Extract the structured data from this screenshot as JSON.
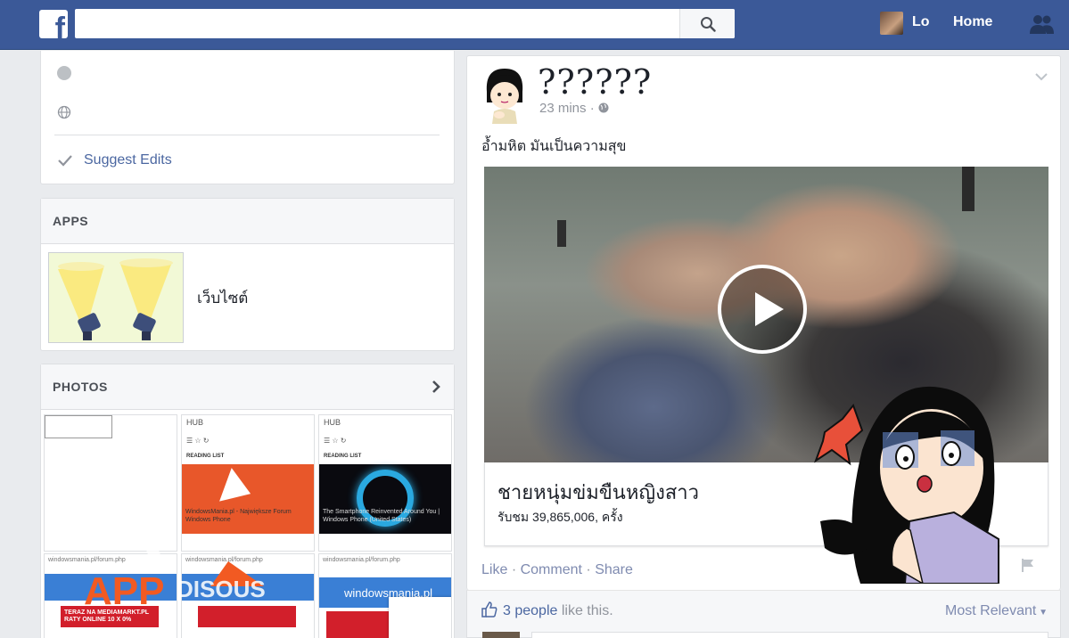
{
  "topbar": {
    "logo_letter": "f",
    "search_placeholder": "",
    "user_name": "Lo",
    "home_label": "Home",
    "brand_color": "#3b5998"
  },
  "about": {
    "suggest_edits": "Suggest Edits"
  },
  "apps": {
    "heading": "APPS",
    "app_label": "เว็บไซต์"
  },
  "photos": {
    "heading": "PHOTOS",
    "thumbnails": [
      {
        "hub": "HUB",
        "list": "READING LIST",
        "caption": "WindowsMania.pl - Największe Forum Windows Phone"
      },
      {
        "hub": "HUB",
        "list": "READING LIST",
        "caption": "The Smartphone Reinvented Around You | Windows Phone (United States)"
      }
    ],
    "bottom_thumbs": [
      {
        "url": "windowsmania.pl/forum.php",
        "banner": "TERAZ NA MEDIAMARKT.PL RATY ONLINE 10 X 0%"
      },
      {
        "url": "windowsmania.pl/forum.php",
        "banner": "TERAZ NA MEDIAMARKT.PL RATY ONLINE 10 X 0%",
        "brand": "windowsmania.pl"
      }
    ]
  },
  "post": {
    "author": "??????",
    "time": "23 mins",
    "text": "อ้ำมหิต มันเป็นความสุข",
    "video_title": "ชายหนุ่มข่มขืนหญิงสาว",
    "video_views": "รับชม 39,865,006, ครั้ง",
    "actions": [
      "Like",
      "Comment",
      "Share"
    ],
    "likes_count": "3 people",
    "likes_suffix": "like this.",
    "sort_label": "Most Relevant"
  }
}
